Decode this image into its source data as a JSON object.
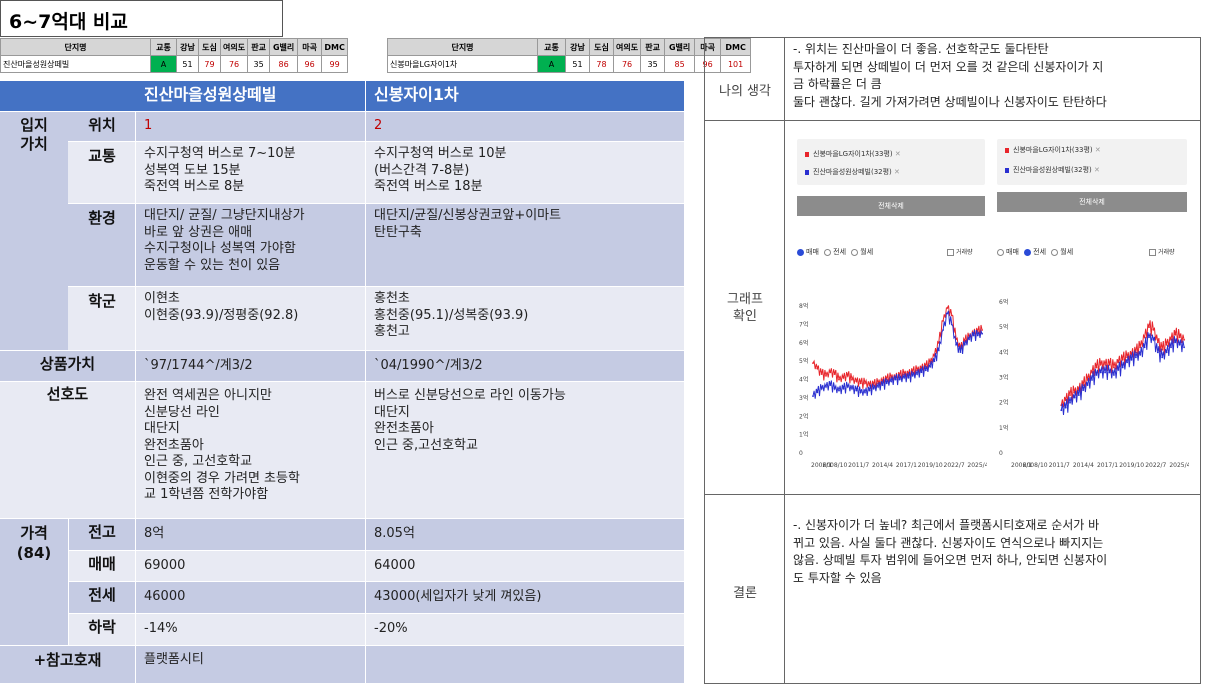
{
  "title": "6~7억대 비교",
  "mini_tables": {
    "headers": [
      "단지명",
      "교통",
      "강남",
      "도심",
      "여의도",
      "판교",
      "G밸리",
      "마곡",
      "DMC"
    ],
    "left": {
      "name": "진산마을성원상떼빌",
      "values": [
        "A",
        "51",
        "79",
        "76",
        "35",
        "86",
        "96",
        "99"
      ]
    },
    "right": {
      "name": "신봉마을LG자이1차",
      "values": [
        "A",
        "51",
        "78",
        "76",
        "35",
        "85",
        "96",
        "101"
      ]
    }
  },
  "main": {
    "col1": "진산마을성원상떼빌",
    "col2": "신봉자이1차",
    "group_location": "입지\n가치",
    "rows": {
      "location": {
        "label": "위치",
        "c1": "1",
        "c2": "2"
      },
      "transport": {
        "label": "교통",
        "c1": "수지구청역 버스로 7~10분\n성복역 도보 15분\n죽전역 버스로 8분",
        "c2": "수지구청역 버스로 10분\n(버스간격 7-8분)\n죽전역 버스로 18분"
      },
      "environment": {
        "label": "환경",
        "c1": "대단지/ 균질/ 그냥단지내상가\n바로 앞 상권은 애매\n수지구청이나 성복역 가야함\n운동할 수 있는 천이 있음",
        "c2": "대단지/균질/신봉상권코앞+이마트\n탄탄구축"
      },
      "school": {
        "label": "학군",
        "c1": "이현초\n이현중(93.9)/정평중(92.8)",
        "c2": "홍천초\n홍천중(95.1)/성복중(93.9)\n홍천고"
      },
      "product": {
        "label": "상품가치",
        "c1": "`97/1744^/계3/2",
        "c2": "`04/1990^/계3/2"
      },
      "preference": {
        "label": "선호도",
        "c1": "완전 역세권은 아니지만\n신분당선 라인\n대단지\n완전초품아\n인근 중, 고선호학교\n이현중의 경우 가려면 초등학\n교 1학년쯤 전학가야함",
        "c2": "버스로 신분당선으로 라인 이동가능\n대단지\n완전초품아\n인근 중,고선호학교"
      }
    },
    "price_group": "가격\n(84)",
    "price": {
      "peak": {
        "label": "전고",
        "c1": "8억",
        "c2": "8.05억"
      },
      "sale": {
        "label": "매매",
        "c1": "69000",
        "c2": "64000"
      },
      "jeonse": {
        "label": "전세",
        "c1": "46000",
        "c2": "43000(세입자가 낮게 껴있음)"
      },
      "drop": {
        "label": "하락",
        "c1": "-14%",
        "c2": "-20%"
      }
    },
    "reference": {
      "label": "+참고호재",
      "c1": "플랫폼시티",
      "c2": ""
    }
  },
  "right": {
    "opinion_label": "나의 생각",
    "opinion_text": "-. 위치는 진산마을이 더 좋음. 선호학군도 둘다탄탄\n투자하게 되면 상떼빌이 더 먼저 오를 것 같은데 신봉자이가 지\n금 하락률은 더 큼\n둘다 괜찮다. 길게 가져가려면 상떼빌이나 신봉자이도 탄탄하다",
    "graph_label": "그래프\n확인",
    "conclusion_label": "결론",
    "conclusion_text": "-. 신봉자이가 더 높네? 최근에서 플랫폼시티호재로 순서가 바\n뀌고 있음. 사실 둘다 괜찮다. 신봉자이도 연식으로나 빠지지는\n않음. 상떼빌 투자 범위에 들어오면 먼저 하나, 안되면 신봉자이\n도 투자할 수 있음",
    "chart_ui": {
      "reset": "전체삭제",
      "radio": [
        "매매",
        "전세",
        "월세"
      ],
      "checkbox": "거래량"
    }
  },
  "chart_data": [
    {
      "type": "line",
      "legend": [
        "신봉마을LG자이1차(33평)",
        "진산마을성원상떼빌(32평)"
      ],
      "selected_mode": "매매",
      "y_ticks": [
        "0",
        "1억",
        "2억",
        "3억",
        "4억",
        "5억",
        "6억",
        "7억",
        "8억"
      ],
      "x_ticks": [
        "2006/1",
        "2008/10",
        "2011/7",
        "2014/4",
        "2017/1",
        "2019/10",
        "2022/7",
        "2025/4"
      ],
      "ylim": [
        0,
        8.5
      ],
      "series": [
        {
          "name": "신봉마을LG자이1차(33평)",
          "color": "#e8252b",
          "x": [
            2006.0,
            2006.5,
            2007.0,
            2007.5,
            2008.0,
            2008.5,
            2009.0,
            2009.5,
            2010.0,
            2010.5,
            2011.0,
            2011.5,
            2012.0,
            2012.5,
            2013.0,
            2013.5,
            2014.0,
            2014.5,
            2015.0,
            2015.5,
            2016.0,
            2016.5,
            2017.0,
            2017.5,
            2018.0,
            2018.5,
            2019.0,
            2019.5,
            2020.0,
            2020.5,
            2021.0,
            2021.5,
            2022.0,
            2022.5,
            2023.0,
            2023.5,
            2024.0,
            2024.5,
            2025.0,
            2025.5
          ],
          "y": [
            4.9,
            4.6,
            4.3,
            4.2,
            4.4,
            4.3,
            4.0,
            4.1,
            4.2,
            4.0,
            3.9,
            3.8,
            3.8,
            3.7,
            3.7,
            3.8,
            3.9,
            4.0,
            4.1,
            4.1,
            4.2,
            4.3,
            4.3,
            4.4,
            4.5,
            4.6,
            4.7,
            4.9,
            5.3,
            6.0,
            7.2,
            7.9,
            7.5,
            6.2,
            5.7,
            6.1,
            6.3,
            6.5,
            6.6,
            6.7
          ]
        },
        {
          "name": "진산마을성원상떼빌(32평)",
          "color": "#2a2fd0",
          "x": [
            2006.0,
            2006.5,
            2007.0,
            2007.5,
            2008.0,
            2008.5,
            2009.0,
            2009.5,
            2010.0,
            2010.5,
            2011.0,
            2011.5,
            2012.0,
            2012.5,
            2013.0,
            2013.5,
            2014.0,
            2014.5,
            2015.0,
            2015.5,
            2016.0,
            2016.5,
            2017.0,
            2017.5,
            2018.0,
            2018.5,
            2019.0,
            2019.5,
            2020.0,
            2020.5,
            2021.0,
            2021.5,
            2022.0,
            2022.5,
            2023.0,
            2023.5,
            2024.0,
            2024.5,
            2025.0,
            2025.5
          ],
          "y": [
            3.1,
            3.3,
            3.5,
            3.6,
            3.7,
            3.5,
            3.4,
            3.5,
            3.6,
            3.5,
            3.4,
            3.3,
            3.3,
            3.4,
            3.5,
            3.6,
            3.7,
            3.8,
            3.9,
            4.0,
            4.0,
            4.1,
            4.1,
            4.2,
            4.3,
            4.4,
            4.5,
            4.7,
            5.0,
            5.6,
            6.7,
            7.6,
            7.0,
            5.9,
            5.5,
            5.9,
            6.2,
            6.4,
            6.4,
            6.5
          ]
        }
      ]
    },
    {
      "type": "line",
      "legend": [
        "신봉마을LG자이1차(33평)",
        "진산마을성원상떼빌(32평)"
      ],
      "selected_mode": "전세",
      "y_ticks": [
        "0",
        "1억",
        "2억",
        "3억",
        "4억",
        "5억",
        "6억"
      ],
      "x_ticks": [
        "2006/1",
        "2008/10",
        "2011/7",
        "2014/4",
        "2017/1",
        "2019/10",
        "2022/7",
        "2025/4"
      ],
      "ylim": [
        0,
        6.2
      ],
      "series": [
        {
          "name": "신봉마을LG자이1차(33평)",
          "color": "#e8252b",
          "x": [
            2011.5,
            2012.0,
            2012.5,
            2013.0,
            2013.5,
            2014.0,
            2014.5,
            2015.0,
            2015.5,
            2016.0,
            2016.5,
            2017.0,
            2017.5,
            2018.0,
            2018.5,
            2019.0,
            2019.5,
            2020.0,
            2020.5,
            2021.0,
            2021.5,
            2022.0,
            2022.5,
            2023.0,
            2023.5,
            2024.0,
            2024.5,
            2025.0,
            2025.5
          ],
          "y": [
            1.9,
            2.1,
            2.3,
            2.4,
            2.5,
            2.7,
            2.9,
            3.2,
            3.4,
            3.5,
            3.5,
            3.5,
            3.4,
            3.6,
            3.7,
            3.8,
            3.9,
            4.0,
            4.2,
            4.6,
            5.0,
            4.9,
            4.4,
            4.1,
            4.3,
            4.5,
            4.7,
            4.6,
            4.5
          ]
        },
        {
          "name": "진산마을성원상떼빌(32평)",
          "color": "#2a2fd0",
          "x": [
            2011.5,
            2012.0,
            2012.5,
            2013.0,
            2013.5,
            2014.0,
            2014.5,
            2015.0,
            2015.5,
            2016.0,
            2016.5,
            2017.0,
            2017.5,
            2018.0,
            2018.5,
            2019.0,
            2019.5,
            2020.0,
            2020.5,
            2021.0,
            2021.5,
            2022.0,
            2022.5,
            2023.0,
            2023.5,
            2024.0,
            2024.5,
            2025.0,
            2025.5
          ],
          "y": [
            1.7,
            1.8,
            2.0,
            2.2,
            2.3,
            2.5,
            2.7,
            2.9,
            3.1,
            3.2,
            3.2,
            3.2,
            3.1,
            3.3,
            3.4,
            3.6,
            3.7,
            3.8,
            3.9,
            4.2,
            4.6,
            4.5,
            4.0,
            3.8,
            4.0,
            4.2,
            4.4,
            4.3,
            4.2
          ]
        }
      ]
    }
  ]
}
